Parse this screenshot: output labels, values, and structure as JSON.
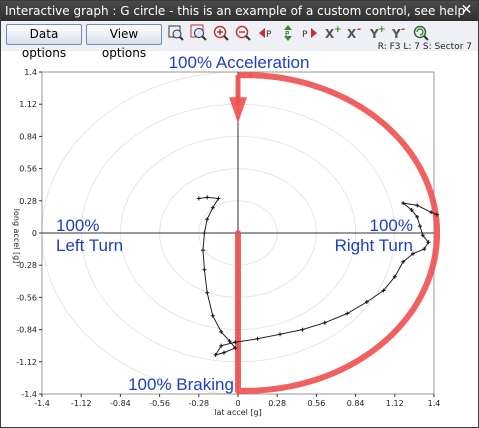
{
  "window": {
    "title": "Interactive graph : G circle  - this is an example of a custom control, see help",
    "close_glyph": "✕"
  },
  "toolbar": {
    "data_options_label": "Data options",
    "view_options_label": "View options",
    "icons": [
      "zoom-window-icon",
      "zoom-fit-icon",
      "zoom-in-icon",
      "zoom-out-icon",
      "pan-left-icon",
      "pan-up-down-icon",
      "pan-right-icon",
      "x-plus-icon",
      "x-minus-icon",
      "y-plus-icon",
      "y-minus-icon",
      "zoom-reset-icon"
    ],
    "status": "R: F3  L: 7  S: Sector 7"
  },
  "chart_data": {
    "type": "scatter",
    "title": "",
    "xlabel": "lat accel [g]",
    "ylabel": "long accel [g]",
    "xlim": [
      -1.4,
      1.4
    ],
    "ylim": [
      -1.4,
      1.4
    ],
    "x_ticks": [
      "-1.4",
      "-1.12",
      "-0.84",
      "-0.56",
      "-0.28",
      "0",
      "0.28",
      "0.56",
      "0.84",
      "1.12",
      "1.4"
    ],
    "y_ticks": [
      "1.4",
      "1.12",
      "0.84",
      "0.56",
      "0.28",
      "0",
      "-0.28",
      "-0.56",
      "-0.84",
      "-1.12",
      "-1.4"
    ],
    "grid": "concentric circles",
    "annotations": {
      "top": "100% Acceleration",
      "bottom": "100% Braking",
      "left_1": "100%",
      "left_2": "Left Turn",
      "right_1": "100%",
      "right_2": "Right Turn"
    },
    "envelope_color": "#f05050",
    "annotation_color": "#1e3fbf",
    "series": [
      {
        "points": [
          [
            -0.28,
            0.3
          ],
          [
            -0.22,
            0.31
          ],
          [
            -0.14,
            0.3
          ],
          [
            -0.18,
            0.22
          ],
          [
            -0.22,
            0.12
          ],
          [
            -0.24,
            0.0
          ],
          [
            -0.25,
            -0.15
          ],
          [
            -0.24,
            -0.32
          ],
          [
            -0.22,
            -0.52
          ],
          [
            -0.18,
            -0.72
          ],
          [
            -0.12,
            -0.86
          ],
          [
            -0.06,
            -0.94
          ],
          [
            -0.02,
            -1.0
          ],
          [
            -0.1,
            -1.04
          ],
          [
            -0.16,
            -1.06
          ],
          [
            -0.12,
            -0.98
          ],
          [
            -0.02,
            -0.95
          ],
          [
            0.14,
            -0.92
          ],
          [
            0.3,
            -0.88
          ],
          [
            0.46,
            -0.84
          ],
          [
            0.62,
            -0.78
          ],
          [
            0.78,
            -0.7
          ],
          [
            0.92,
            -0.6
          ],
          [
            1.04,
            -0.5
          ],
          [
            1.12,
            -0.38
          ],
          [
            1.18,
            -0.25
          ],
          [
            1.25,
            -0.18
          ],
          [
            1.33,
            -0.14
          ],
          [
            1.36,
            -0.08
          ],
          [
            1.32,
            -0.02
          ],
          [
            1.3,
            0.06
          ],
          [
            1.28,
            0.14
          ],
          [
            1.24,
            0.2
          ],
          [
            1.18,
            0.26
          ],
          [
            1.28,
            0.24
          ],
          [
            1.38,
            0.18
          ],
          [
            1.42,
            0.16
          ]
        ]
      }
    ]
  }
}
